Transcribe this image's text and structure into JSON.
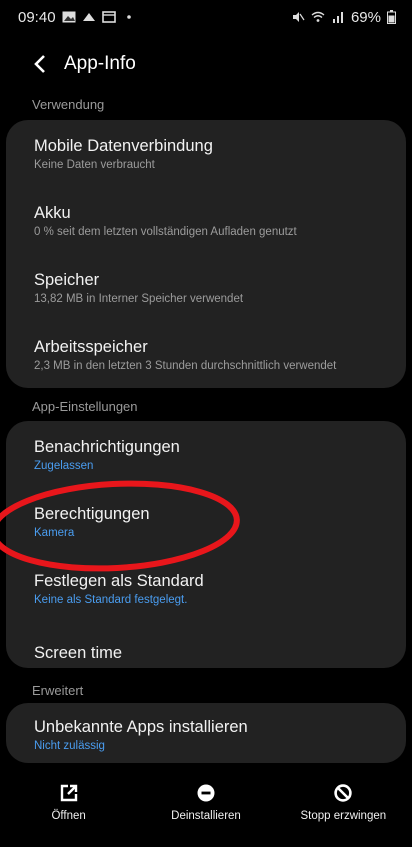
{
  "status_bar": {
    "time": "09:40",
    "battery": "69%",
    "left_icons": [
      "gallery-icon",
      "cloud-icon",
      "message-icon",
      "dot-icon"
    ],
    "right_icons": [
      "mute-icon",
      "wifi-icon",
      "signal-icon",
      "battery-icon"
    ]
  },
  "app_bar": {
    "title": "App-Info"
  },
  "sections": {
    "usage": {
      "header": "Verwendung",
      "items": [
        {
          "title": "Mobile Datenverbindung",
          "subtitle": "Keine Daten verbraucht"
        },
        {
          "title": "Akku",
          "subtitle": "0 % seit dem letzten vollständigen Aufladen genutzt"
        },
        {
          "title": "Speicher",
          "subtitle": "13,82 MB in Interner Speicher verwendet"
        },
        {
          "title": "Arbeitsspeicher",
          "subtitle": "2,3 MB in den letzten 3 Stunden durchschnittlich verwendet"
        }
      ]
    },
    "app_settings": {
      "header": "App-Einstellungen",
      "items": [
        {
          "title": "Benachrichtigungen",
          "subtitle": "Zugelassen"
        },
        {
          "title": "Berechtigungen",
          "subtitle": "Kamera"
        },
        {
          "title": "Festlegen als Standard",
          "subtitle": "Keine als Standard festgelegt."
        },
        {
          "title": "Screen time"
        }
      ]
    },
    "advanced": {
      "header": "Erweitert",
      "items": [
        {
          "title": "Unbekannte Apps installieren",
          "subtitle": "Nicht zulässig"
        }
      ]
    }
  },
  "bottom_actions": {
    "open": "Öffnen",
    "uninstall": "Deinstallieren",
    "force_stop": "Stopp erzwingen"
  },
  "colors": {
    "background": "#000000",
    "card": "#222222",
    "link_blue": "#4a9df0",
    "annotation_red": "#e8161b"
  }
}
